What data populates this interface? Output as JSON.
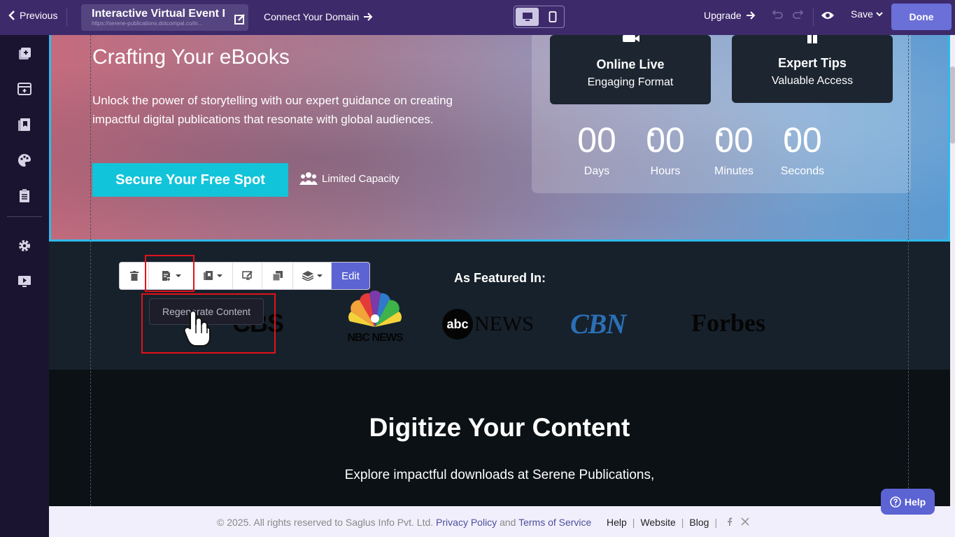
{
  "topbar": {
    "previous_label": "Previous",
    "site_title": "Interactive Virtual Event F...",
    "site_url": "https://serene-publications.dotcompal.co/in...",
    "connect_label": "Connect Your Domain",
    "upgrade_label": "Upgrade",
    "save_label": "Save",
    "done_label": "Done"
  },
  "hero": {
    "heading": "Crafting Your eBooks",
    "paragraph": "Unlock the power of storytelling with our expert guidance on creating impactful digital publications that resonate with global audiences.",
    "cta_label": "Secure Your Free Spot",
    "capacity_label": "Limited Capacity",
    "cards": [
      {
        "title": "Online Live",
        "subtitle": "Engaging Format"
      },
      {
        "title": "Expert Tips",
        "subtitle": "Valuable Access"
      }
    ],
    "countdown": {
      "days": "00",
      "hours": "00",
      "minutes": "00",
      "seconds": "00",
      "days_label": "Days",
      "hours_label": "Hours",
      "minutes_label": "Minutes",
      "seconds_label": "Seconds",
      "separator": ":"
    }
  },
  "featured": {
    "title": "As Featured In:",
    "logos": {
      "cbs": "CBS",
      "nbc": "NBC NEWS",
      "abc_mark": "abc",
      "abc_text": "NEWS",
      "cbn": "CBN",
      "forbes": "Forbes"
    }
  },
  "digitize": {
    "title": "Digitize Your Content",
    "paragraph": "Explore impactful downloads at Serene Publications,"
  },
  "toolbar": {
    "edit_label": "Edit",
    "dropdown_item": "Regenerate Content"
  },
  "footer": {
    "copyright": "©  2025. All rights reserved to Saglus Info Pvt. Ltd.",
    "privacy": "Privacy Policy",
    "and": "and",
    "terms": "Terms of Service",
    "help": "Help",
    "website": "Website",
    "blog": "Blog",
    "separator": "|"
  },
  "help_button_label": "Help",
  "colors": {
    "topbar": "#3d2a6b",
    "accent": "#5c63d3",
    "cta": "#12c4d9",
    "highlight": "#e0121a",
    "selection": "#2fb9ea"
  }
}
